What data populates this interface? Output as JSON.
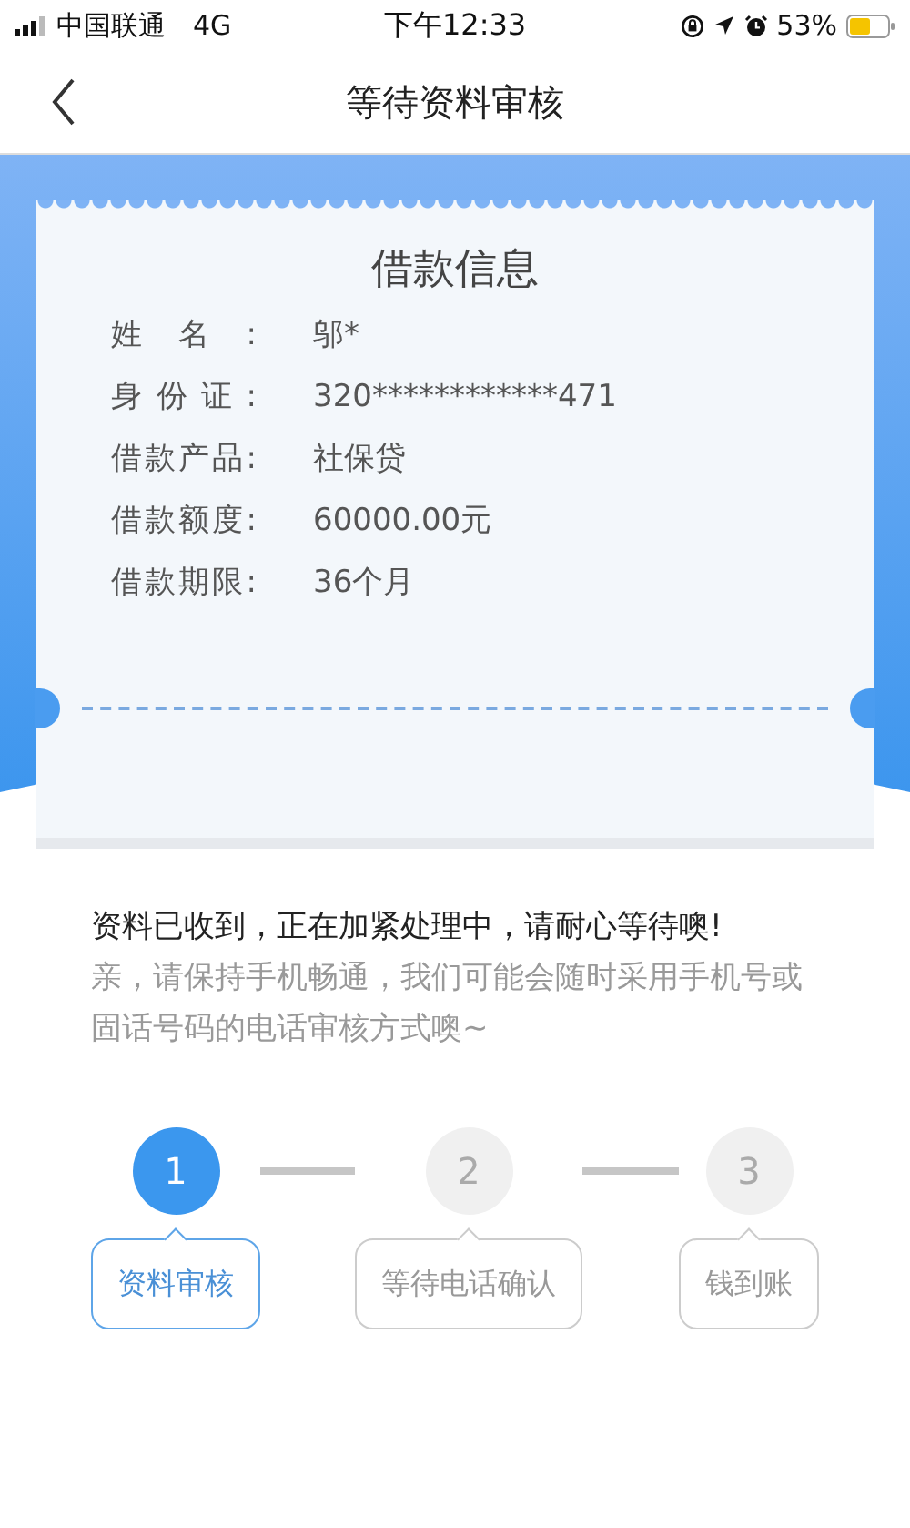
{
  "status_bar": {
    "carrier": "中国联通",
    "network": "4G",
    "time": "下午12:33",
    "battery": "53%"
  },
  "nav": {
    "title": "等待资料审核"
  },
  "loan_info": {
    "title": "借款信息",
    "fields": [
      {
        "label": "姓名:",
        "value": "邬*"
      },
      {
        "label": "身份证:",
        "value": "320************471"
      },
      {
        "label": "借款产品:",
        "value": "社保贷"
      },
      {
        "label": "借款额度:",
        "value": "60000.00元"
      },
      {
        "label": "借款期限:",
        "value": "36个月"
      }
    ]
  },
  "messages": [
    {
      "kind": "primary",
      "text": "资料已收到，正在加紧处理中，请耐心等待噢!"
    },
    {
      "kind": "secondary",
      "text": "亲，请保持手机畅通，我们可能会随时采用手机号或固话号码的电话审核方式噢~"
    }
  ],
  "steps": [
    {
      "number": "1",
      "label": "资料审核",
      "selected": true
    },
    {
      "number": "2",
      "label": "等待电话确认",
      "selected": false
    },
    {
      "number": "3",
      "label": "钱到账",
      "selected": false
    }
  ]
}
